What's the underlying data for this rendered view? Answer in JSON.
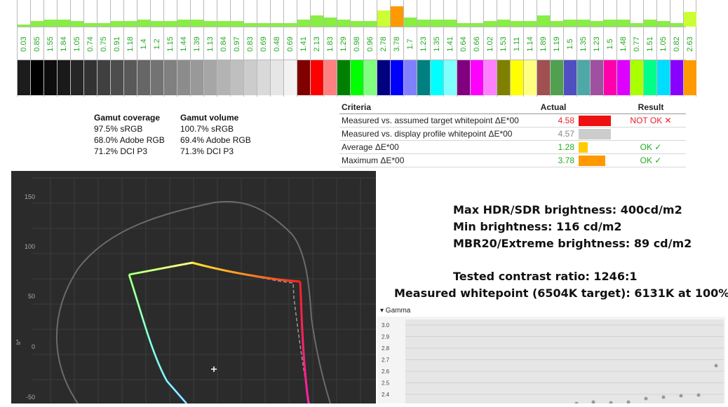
{
  "strip": {
    "columns": [
      {
        "value": "0.03",
        "bar": 1,
        "swatch": "#1c1c1c"
      },
      {
        "value": "0.85",
        "bar": 3,
        "swatch": "#000000"
      },
      {
        "value": "1.55",
        "bar": 4,
        "swatch": "#0d0d0d"
      },
      {
        "value": "1.84",
        "bar": 4,
        "swatch": "#1a1a1a"
      },
      {
        "value": "1.05",
        "bar": 3,
        "swatch": "#262626"
      },
      {
        "value": "0.74",
        "bar": 2,
        "swatch": "#333333"
      },
      {
        "value": "0.75",
        "bar": 2,
        "swatch": "#404040"
      },
      {
        "value": "0.91",
        "bar": 3,
        "swatch": "#4d4d4d"
      },
      {
        "value": "1.18",
        "bar": 3,
        "swatch": "#595959"
      },
      {
        "value": "1.4",
        "bar": 4,
        "swatch": "#666666"
      },
      {
        "value": "1.2",
        "bar": 3,
        "swatch": "#737373"
      },
      {
        "value": "1.15",
        "bar": 3,
        "swatch": "#808080"
      },
      {
        "value": "1.44",
        "bar": 4,
        "swatch": "#8c8c8c"
      },
      {
        "value": "1.39",
        "bar": 4,
        "swatch": "#999999"
      },
      {
        "value": "1.13",
        "bar": 3,
        "swatch": "#a6a6a6"
      },
      {
        "value": "0.84",
        "bar": 3,
        "swatch": "#b3b3b3"
      },
      {
        "value": "0.97",
        "bar": 3,
        "swatch": "#bfbfbf"
      },
      {
        "value": "0.83",
        "bar": 2,
        "swatch": "#cccccc"
      },
      {
        "value": "0.69",
        "bar": 2,
        "swatch": "#d9d9d9"
      },
      {
        "value": "0.48",
        "bar": 2,
        "swatch": "#e6e6e6"
      },
      {
        "value": "0.69",
        "bar": 2,
        "swatch": "#f2f2f2"
      },
      {
        "value": "1.41",
        "bar": 4,
        "swatch": "#800000"
      },
      {
        "value": "2.13",
        "bar": 6,
        "swatch": "#ff0000"
      },
      {
        "value": "1.83",
        "bar": 5,
        "swatch": "#ff8080"
      },
      {
        "value": "1.29",
        "bar": 4,
        "swatch": "#008000"
      },
      {
        "value": "0.98",
        "bar": 3,
        "swatch": "#00ff00"
      },
      {
        "value": "0.96",
        "bar": 3,
        "swatch": "#80ff80"
      },
      {
        "value": "2.78",
        "bar": 9,
        "swatch": "#000080"
      },
      {
        "value": "3.78",
        "bar": 11,
        "swatch": "#0000ff"
      },
      {
        "value": "1.7",
        "bar": 5,
        "swatch": "#8080ff"
      },
      {
        "value": "1.23",
        "bar": 4,
        "swatch": "#008080"
      },
      {
        "value": "1.35",
        "bar": 4,
        "swatch": "#00ffff"
      },
      {
        "value": "1.41",
        "bar": 4,
        "swatch": "#80ffff"
      },
      {
        "value": "0.64",
        "bar": 2,
        "swatch": "#800080"
      },
      {
        "value": "0.66",
        "bar": 2,
        "swatch": "#ff00ff"
      },
      {
        "value": "1.02",
        "bar": 3,
        "swatch": "#ff80ff"
      },
      {
        "value": "1.53",
        "bar": 4,
        "swatch": "#808000"
      },
      {
        "value": "1.11",
        "bar": 3,
        "swatch": "#ffff00"
      },
      {
        "value": "1.14",
        "bar": 3,
        "swatch": "#ffff80"
      },
      {
        "value": "1.89",
        "bar": 6,
        "swatch": "#a05050"
      },
      {
        "value": "1.19",
        "bar": 3,
        "swatch": "#50a050"
      },
      {
        "value": "1.5",
        "bar": 4,
        "swatch": "#4f4fbf"
      },
      {
        "value": "1.35",
        "bar": 4,
        "swatch": "#4fa8a8"
      },
      {
        "value": "1.23",
        "bar": 3,
        "swatch": "#a050a0"
      },
      {
        "value": "1.5",
        "bar": 4,
        "swatch": "#ff00aa"
      },
      {
        "value": "1.48",
        "bar": 4,
        "swatch": "#dd00ff"
      },
      {
        "value": "0.77",
        "bar": 2,
        "swatch": "#aaff00"
      },
      {
        "value": "1.51",
        "bar": 4,
        "swatch": "#00ff88"
      },
      {
        "value": "1.05",
        "bar": 3,
        "swatch": "#00ddff"
      },
      {
        "value": "0.82",
        "bar": 2,
        "swatch": "#8800ff"
      },
      {
        "value": "2.63",
        "bar": 8,
        "swatch": "#ff9900"
      }
    ],
    "bar_green": "#88ee44",
    "bar_yellowgreen": "#ccff33",
    "bar_orange": "#ff9900"
  },
  "gamut": {
    "coverage_title": "Gamut coverage",
    "coverage": [
      "97.5% sRGB",
      "68.0% Adobe RGB",
      "71.2% DCI P3"
    ],
    "volume_title": "Gamut volume",
    "volume": [
      "100.7% sRGB",
      "69.4% Adobe RGB",
      "71.3% DCI P3"
    ]
  },
  "criteria": {
    "headers": {
      "criteria": "Criteria",
      "actual": "Actual",
      "result": "Result"
    },
    "rows": [
      {
        "label": "Measured vs. assumed target whitepoint ΔE*00",
        "actual": "4.58",
        "actual_color": "#e8202a",
        "bar_pct": 1.0,
        "bar_color": "#ee1111",
        "result": "NOT OK ✕",
        "result_color": "#e8202a"
      },
      {
        "label": "Measured vs. display profile whitepoint ΔE*00",
        "actual": "4.57",
        "actual_color": "#888888",
        "bar_pct": 1.0,
        "bar_color": "#cccccc",
        "result": "",
        "result_color": "#888888"
      },
      {
        "label": "Average ΔE*00",
        "actual": "1.28",
        "actual_color": "#22aa22",
        "bar_pct": 0.29,
        "bar_color": "#ffcc00",
        "result": "OK ✓",
        "result_color": "#22aa22"
      },
      {
        "label": "Maximum ΔE*00",
        "actual": "3.78",
        "actual_color": "#22aa22",
        "bar_pct": 0.83,
        "bar_color": "#ff9900",
        "result": "OK ✓",
        "result_color": "#22aa22"
      }
    ]
  },
  "chart": {
    "y_ticks": [
      "150",
      "100",
      "50",
      "0",
      "-50"
    ],
    "y_label": "b*"
  },
  "info": {
    "max_brightness": "Max HDR/SDR brightness: 400cd/m2",
    "min_brightness": "Min brightness: 116 cd/m2",
    "mbr_brightness": "MBR20/Extreme brightness: 89 cd/m2",
    "contrast": "Tested contrast ratio: 1246:1",
    "whitepoint": "Measured whitepoint (6504K target): 6131K at 100%"
  },
  "gamma": {
    "title": "▾ Gamma",
    "y_ticks": [
      "3.0",
      "2.9",
      "2.8",
      "2.7",
      "2.6",
      "2.5",
      "2.4"
    ]
  }
}
